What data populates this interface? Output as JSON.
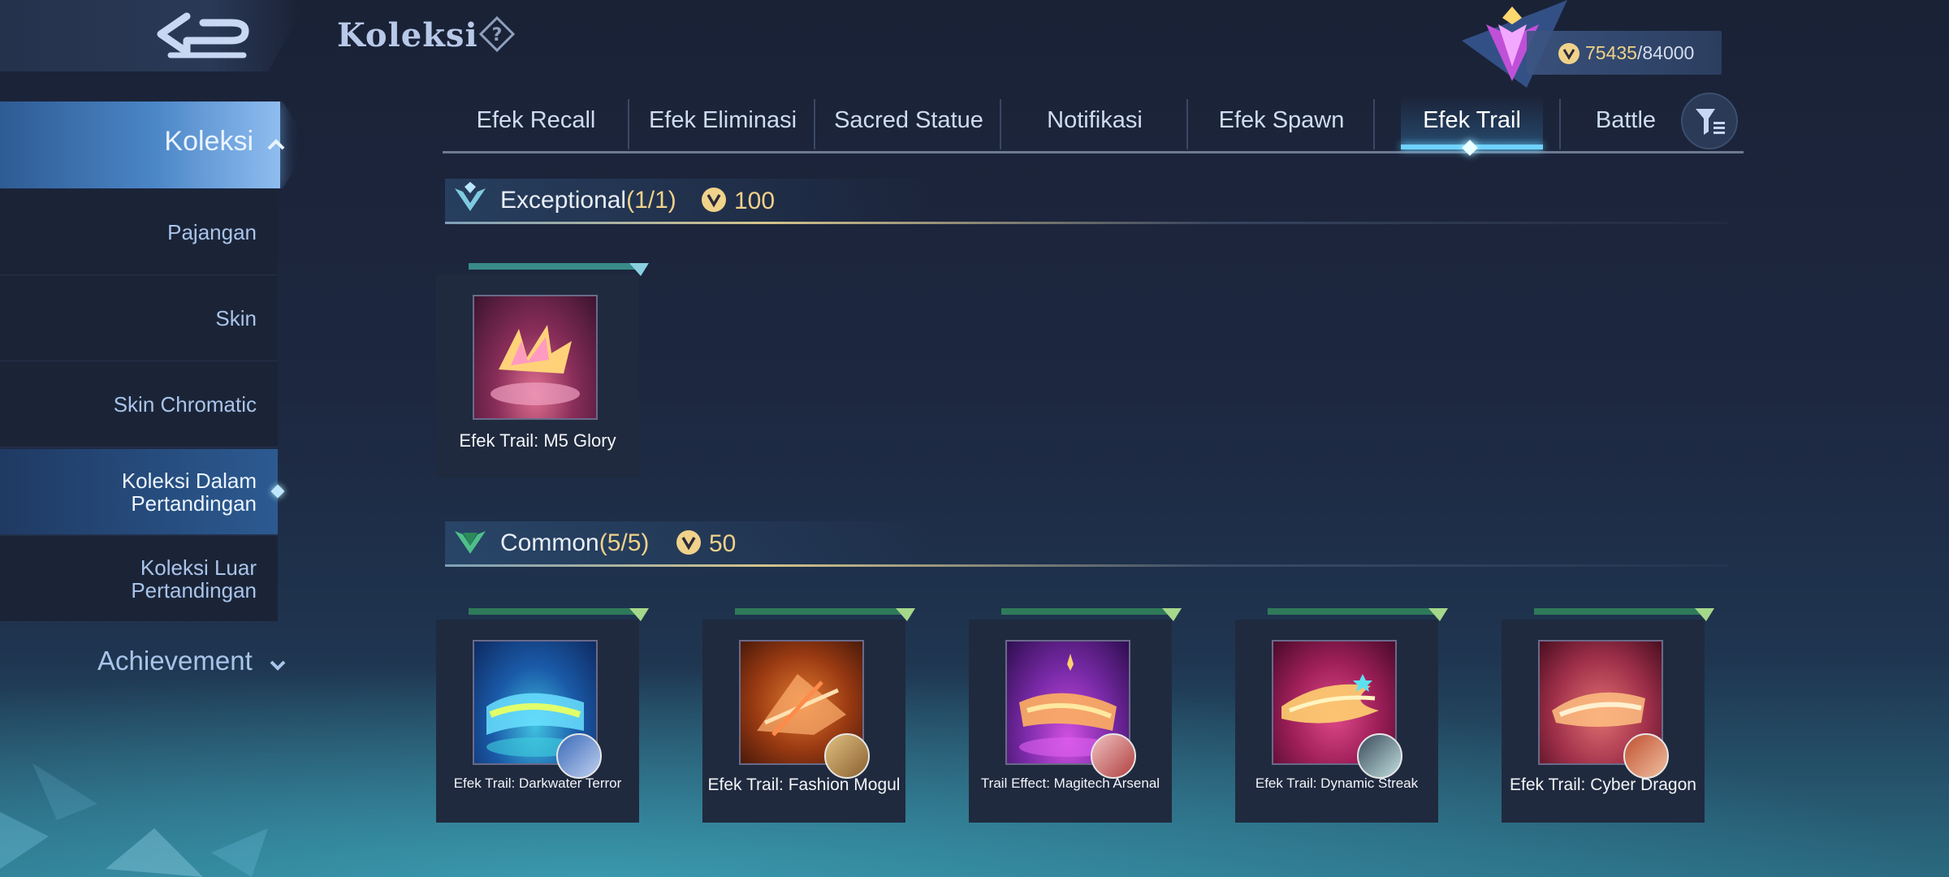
{
  "header": {
    "title": "Koleksi",
    "help_icon": "question-diamond-icon",
    "back_icon": "back-arrow-icon"
  },
  "currency": {
    "current": "75435",
    "separator": "/",
    "max": "84000",
    "icon": "collection-coin-icon"
  },
  "sidebar": {
    "main_label": "Koleksi",
    "items": [
      {
        "label": "Pajangan",
        "active": false
      },
      {
        "label": "Skin",
        "active": false
      },
      {
        "label": "Skin Chromatic",
        "active": false
      },
      {
        "label": "Koleksi Dalam Pertandingan",
        "active": true
      },
      {
        "label": "Koleksi Luar Pertandingan",
        "active": false
      }
    ],
    "achievement_label": "Achievement"
  },
  "tabs": [
    {
      "label": "Efek Recall"
    },
    {
      "label": "Efek Eliminasi"
    },
    {
      "label": "Sacred Statue"
    },
    {
      "label": "Notifikasi"
    },
    {
      "label": "Efek Spawn"
    },
    {
      "label": "Efek Trail",
      "active": true
    },
    {
      "label": "Battle"
    }
  ],
  "sections": [
    {
      "name": "Exceptional",
      "count": "(1/1)",
      "points": "100",
      "items": [
        {
          "name": "Efek Trail: M5 Glory"
        }
      ]
    },
    {
      "name": "Common",
      "count": "(5/5)",
      "points": "50",
      "items": [
        {
          "name": "Efek Trail: Darkwater Terror"
        },
        {
          "name": "Efek Trail: Fashion Mogul"
        },
        {
          "name": "Trail Effect: Magitech Arsenal"
        },
        {
          "name": "Efek Trail: Dynamic Streak"
        },
        {
          "name": "Efek Trail: Cyber Dragon"
        }
      ]
    }
  ],
  "colors": {
    "accent": "#6fd2ff",
    "gold": "#f0d28a",
    "panel": "#202a3e"
  }
}
